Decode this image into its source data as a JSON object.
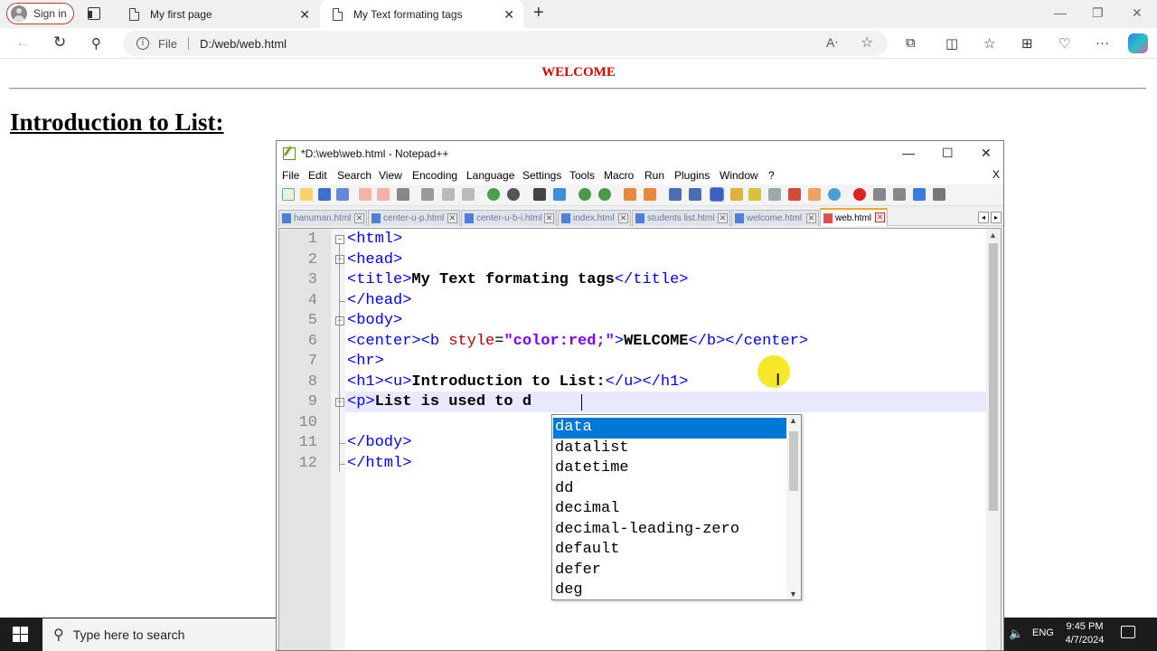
{
  "browser": {
    "sign_in": "Sign in",
    "tabs": [
      {
        "title": "My first page"
      },
      {
        "title": "My Text formating tags"
      }
    ],
    "address": {
      "scheme_label": "File",
      "url": "D:/web/web.html"
    }
  },
  "page": {
    "welcome": "WELCOME",
    "heading": "Introduction to List:",
    "welcome_color": "#e00000"
  },
  "npp": {
    "title": "*D:\\web\\web.html - Notepad++",
    "menu": [
      "File",
      "Edit",
      "Search",
      "View",
      "Encoding",
      "Language",
      "Settings",
      "Tools",
      "Macro",
      "Run",
      "Plugins",
      "Window",
      "?"
    ],
    "menu_close": "X",
    "file_tabs": [
      "hanuman.html",
      "center-u-p.html",
      "center-u-b-i.html",
      "index.html",
      "students list.html",
      "welcome.html",
      "web.html"
    ],
    "line_numbers": [
      "1",
      "2",
      "3",
      "4",
      "5",
      "6",
      "7",
      "8",
      "9",
      "10",
      "11",
      "12"
    ],
    "code": {
      "l1": "<html>",
      "l2": "<head>",
      "l3_open": "<title>",
      "l3_text": "My Text formating tags",
      "l3_close": "</title>",
      "l4": "</head>",
      "l5": "<body>",
      "l6_a": "<center><b ",
      "l6_attr": "style",
      "l6_eq": "=",
      "l6_val": "\"color:red;\"",
      "l6_b": ">",
      "l6_text": "WELCOME",
      "l6_close": "</b></center>",
      "l7": "<hr>",
      "l8_open": "<h1><u>",
      "l8_text": "Introduction to List:",
      "l8_close": "</u></h1>",
      "l9_open": "<p>",
      "l9_text": "List is used to d",
      "l11": "</body>",
      "l12": "</html>"
    },
    "autocomplete": [
      "data",
      "datalist",
      "datetime",
      "dd",
      "decimal",
      "decimal-leading-zero",
      "default",
      "defer",
      "deg"
    ],
    "autocomplete_selected": "data"
  },
  "taskbar": {
    "search_placeholder": "Type here to search",
    "lang": "ENG",
    "time": "9:45 PM",
    "date": "4/7/2024"
  }
}
